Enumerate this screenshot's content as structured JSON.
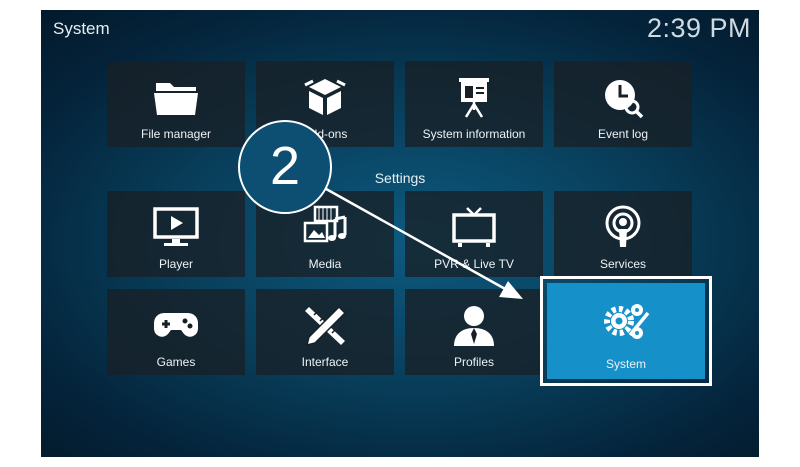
{
  "window": {
    "title": "System",
    "clock": "2:39 PM"
  },
  "section": {
    "label": "Settings"
  },
  "tiles": [
    {
      "label": "File manager",
      "icon": "folder-icon"
    },
    {
      "label": "Add-ons",
      "icon": "box-icon"
    },
    {
      "label": "System information",
      "icon": "presentation-icon"
    },
    {
      "label": "Event log",
      "icon": "clock-search-icon"
    },
    {
      "label": "Player",
      "icon": "monitor-play-icon"
    },
    {
      "label": "Media",
      "icon": "media-icon"
    },
    {
      "label": "PVR & Live TV",
      "icon": "tv-icon"
    },
    {
      "label": "Services",
      "icon": "podcast-icon"
    },
    {
      "label": "Games",
      "icon": "gamepad-icon"
    },
    {
      "label": "Interface",
      "icon": "pencil-ruler-icon"
    },
    {
      "label": "Profiles",
      "icon": "user-icon"
    },
    {
      "label": "System",
      "icon": "gears-icon"
    }
  ],
  "annotation": {
    "step": "2"
  },
  "colors": {
    "accent": "#1590c8",
    "tile": "#182026",
    "background": "#083e5a"
  }
}
